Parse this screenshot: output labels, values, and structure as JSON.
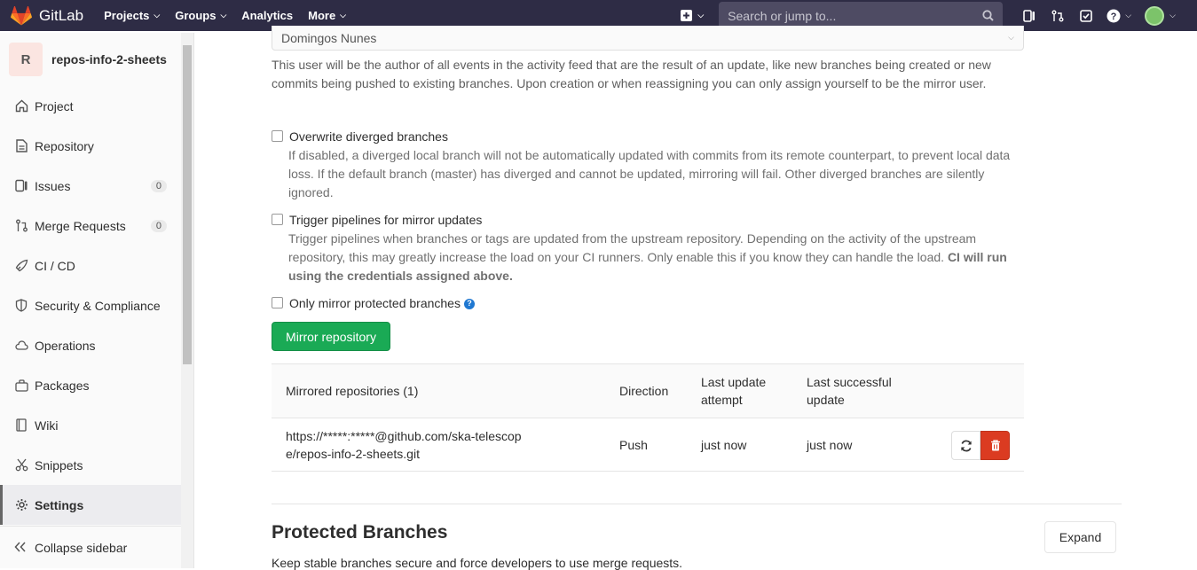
{
  "navbar": {
    "brand": "GitLab",
    "links": [
      "Projects",
      "Groups",
      "Analytics",
      "More"
    ],
    "search_placeholder": "Search or jump to..."
  },
  "sidebar": {
    "avatar_letter": "R",
    "project_name": "repos-info-2-sheets",
    "items": [
      {
        "label": "Project",
        "icon": "home-icon"
      },
      {
        "label": "Repository",
        "icon": "doc-icon"
      },
      {
        "label": "Issues",
        "icon": "issues-icon",
        "count": "0"
      },
      {
        "label": "Merge Requests",
        "icon": "merge-icon",
        "count": "0"
      },
      {
        "label": "CI / CD",
        "icon": "rocket-icon"
      },
      {
        "label": "Security & Compliance",
        "icon": "shield-icon"
      },
      {
        "label": "Operations",
        "icon": "cloud-icon"
      },
      {
        "label": "Packages",
        "icon": "package-icon"
      },
      {
        "label": "Wiki",
        "icon": "book-icon"
      },
      {
        "label": "Snippets",
        "icon": "scissors-icon"
      },
      {
        "label": "Settings",
        "icon": "gear-icon"
      }
    ],
    "collapse_label": "Collapse sidebar"
  },
  "mirror": {
    "mirror_user": "Domingos Nunes",
    "help_text": "This user will be the author of all events in the activity feed that are the result of an update, like new branches being created or new commits being pushed to existing branches. Upon creation or when reassigning you can only assign yourself to be the mirror user.",
    "overwrite_label": "Overwrite diverged branches",
    "overwrite_desc": "If disabled, a diverged local branch will not be automatically updated with commits from its remote counterpart, to prevent local data loss. If the default branch (master) has diverged and cannot be updated, mirroring will fail. Other diverged branches are silently ignored.",
    "trigger_label": "Trigger pipelines for mirror updates",
    "trigger_desc": "Trigger pipelines when branches or tags are updated from the upstream repository. Depending on the activity of the upstream repository, this may greatly increase the load on your CI runners. Only enable this if you know they can handle the load.",
    "trigger_desc_bold": "CI will run using the credentials assigned above.",
    "protected_label": "Only mirror protected branches",
    "mirror_button": "Mirror repository"
  },
  "table": {
    "headers": {
      "repos": "Mirrored repositories (1)",
      "direction": "Direction",
      "last_update": "Last update attempt",
      "last_success": "Last successful update"
    },
    "rows": [
      {
        "url": "https://*****:*****@github.com/ska-telescope/repos-info-2-sheets.git",
        "direction": "Push",
        "last_update": "just now",
        "last_success": "just now"
      }
    ]
  },
  "protected": {
    "title": "Protected Branches",
    "desc": "Keep stable branches secure and force developers to use merge requests.",
    "expand_label": "Expand"
  },
  "colors": {
    "navbar": "#2e2c45",
    "green": "#1aaa55",
    "red": "#db3b21"
  }
}
